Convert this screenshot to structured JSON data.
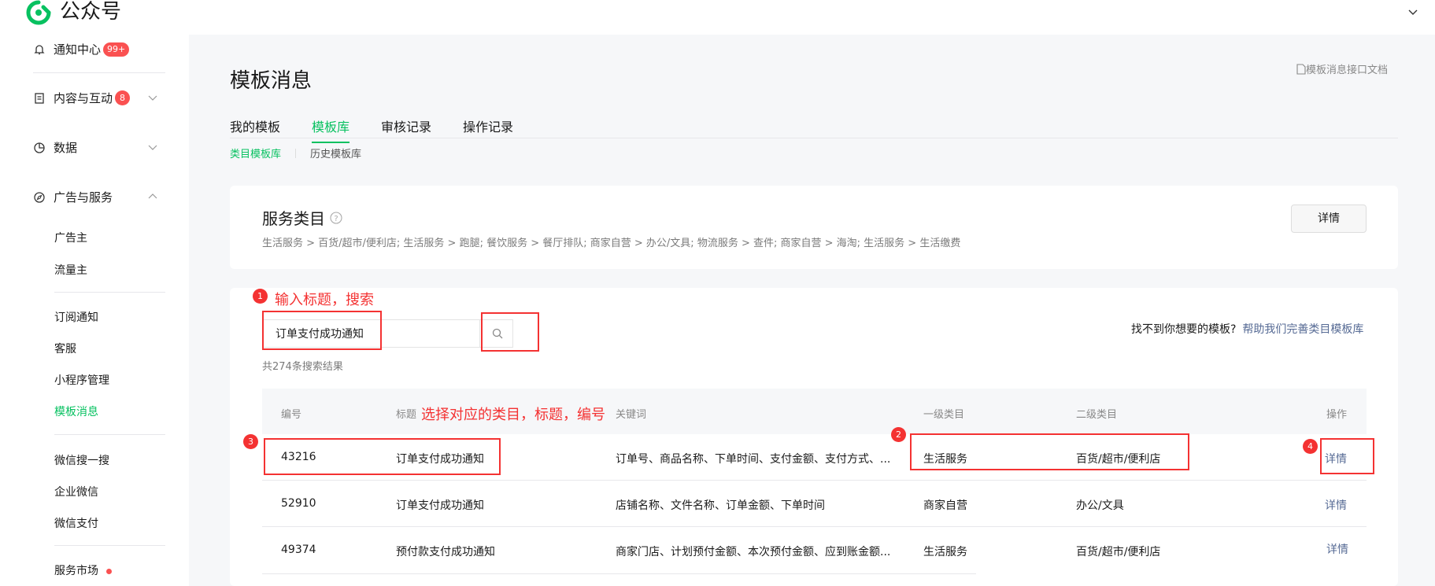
{
  "app": {
    "brand": "公众号"
  },
  "sidebar": {
    "notification": {
      "label": "通知中心",
      "badge": "99+"
    },
    "content": {
      "label": "内容与互动",
      "badge": "8"
    },
    "data": {
      "label": "数据"
    },
    "ads": {
      "label": "广告与服务"
    },
    "ads_sub": [
      "广告主",
      "流量主"
    ],
    "group2": [
      "订阅通知",
      "客服",
      "小程序管理",
      "模板消息"
    ],
    "group3": [
      "微信搜一搜",
      "企业微信",
      "微信支付"
    ],
    "market": "服务市场"
  },
  "page": {
    "title": "模板消息",
    "doc_link": "模板消息接口文档",
    "tabs": [
      "我的模板",
      "模板库",
      "审核记录",
      "操作记录"
    ],
    "active_tab": "模板库",
    "subtabs": [
      "类目模板库",
      "历史模板库"
    ]
  },
  "service": {
    "title": "服务类目",
    "path": "生活服务 > 百货/超市/便利店; 生活服务 > 跑腿; 餐饮服务 > 餐厅排队; 商家自营 > 办公/文具; 物流服务 > 查件; 商家自营 > 海淘; 生活服务 > 生活缴费",
    "detail_btn": "详情"
  },
  "search": {
    "value": "订单支付成功通知",
    "result_count": "共274条搜索结果",
    "cant_find": "找不到你想要的模板?",
    "help_link": "帮助我们完善类目模板库"
  },
  "table": {
    "headers": {
      "id": "编号",
      "title": "标题",
      "keywords": "关键词",
      "cat1": "一级类目",
      "cat2": "二级类目",
      "action": "操作"
    },
    "rows": [
      {
        "id": "43216",
        "title": "订单支付成功通知",
        "keywords": "订单号、商品名称、下单时间、支付金额、支付方式、...",
        "cat1": "生活服务",
        "cat2": "百货/超市/便利店",
        "action": "详情"
      },
      {
        "id": "52910",
        "title": "订单支付成功通知",
        "keywords": "店铺名称、文件名称、订单金额、下单时间",
        "cat1": "商家自营",
        "cat2": "办公/文具",
        "action": "详情"
      },
      {
        "id": "49374",
        "title": "预付款支付成功通知",
        "keywords": "商家门店、计划预付金额、本次预付金额、应到账金额...",
        "cat1": "生活服务",
        "cat2": "百货/超市/便利店",
        "action": "详情"
      }
    ]
  },
  "annotations": {
    "n1": "1",
    "t1": "输入标题，搜索",
    "n2": "2",
    "n3": "3",
    "t3": "选择对应的类目，标题，编号",
    "n4": "4"
  },
  "colors": {
    "accent": "#07c160",
    "link": "#576b95",
    "annotation": "#f43232",
    "badge": "#fa5151"
  }
}
